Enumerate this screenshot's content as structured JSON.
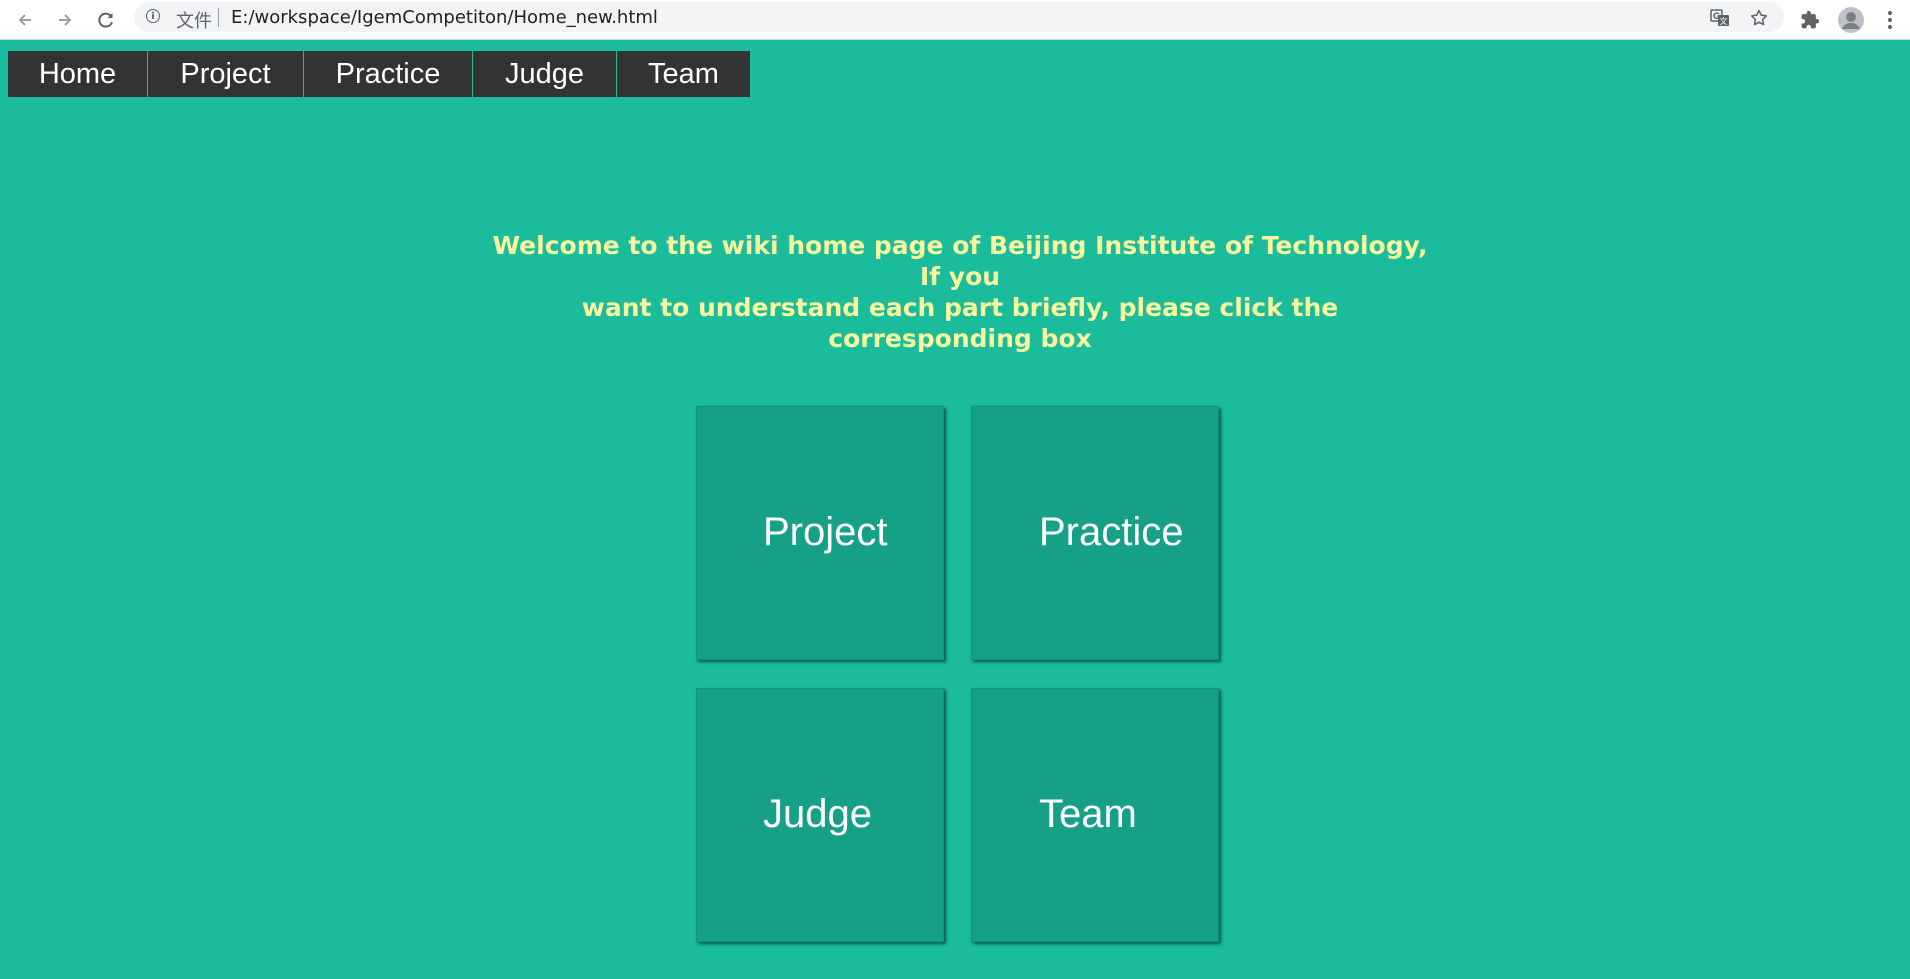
{
  "browser": {
    "scheme_label": "文件",
    "url": "E:/workspace/IgemCompetiton/Home_new.html",
    "icons": [
      "back-icon",
      "forward-icon",
      "reload-icon",
      "info-icon",
      "translate-icon",
      "star-icon",
      "extensions-icon",
      "profile-icon",
      "menu-icon"
    ]
  },
  "nav": {
    "items": [
      {
        "label": "Home"
      },
      {
        "label": "Project"
      },
      {
        "label": "Practice"
      },
      {
        "label": "Judge"
      },
      {
        "label": "Team"
      }
    ]
  },
  "welcome": {
    "line1": "Welcome to the wiki home page of Beijing Institute of Technology, If you",
    "line2": "want to understand each part briefly, please click the corresponding box"
  },
  "tiles": [
    {
      "label": "Project"
    },
    {
      "label": "Practice"
    },
    {
      "label": "Judge"
    },
    {
      "label": "Team"
    }
  ],
  "colors": {
    "background": "#1abc9c",
    "tile": "#16a085",
    "nav": "#333333",
    "welcome_text": "#f7f7a0"
  }
}
